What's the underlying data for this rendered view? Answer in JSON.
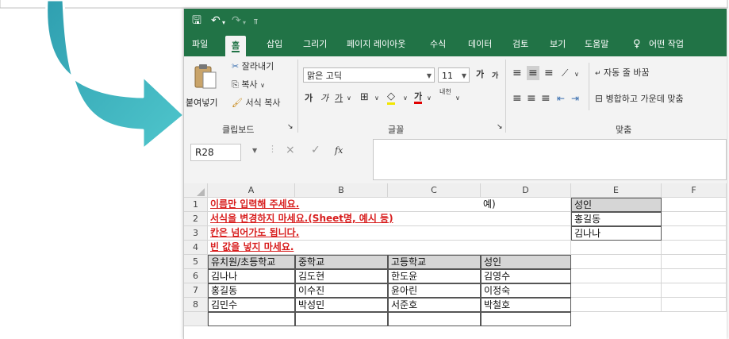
{
  "window": {
    "save_icon": "save-icon",
    "undo_icon": "undo-icon",
    "redo_icon": "redo-icon",
    "qat_icon": "customize-quick-access-icon"
  },
  "tabs": [
    {
      "label": "파일"
    },
    {
      "label": "홈"
    },
    {
      "label": "삽입"
    },
    {
      "label": "그리기"
    },
    {
      "label": "페이지 레이아웃"
    },
    {
      "label": "수식"
    },
    {
      "label": "데이터"
    },
    {
      "label": "검토"
    },
    {
      "label": "보기"
    },
    {
      "label": "도움말"
    },
    {
      "label": "어떤 작업"
    }
  ],
  "ribbon": {
    "clipboard": {
      "paste_label": "붙여넣기",
      "cut_label": "잘라내기",
      "copy_label": "복사",
      "format_painter_label": "서식 복사",
      "group_label": "클립보드"
    },
    "font": {
      "font_name": "맑은 고딕",
      "font_size": "11",
      "grow_label": "가",
      "shrink_label": "가",
      "bold_label": "가",
      "italic_label": "가",
      "underline_label": "가",
      "font_color_label": "가",
      "phonetic_label": "내천",
      "group_label": "글꼴"
    },
    "alignment": {
      "wrap_text_label": "자동 줄 바꿈",
      "merge_label": "병합하고 가운데 맞춤",
      "group_label": "맞춤"
    }
  },
  "formula_bar": {
    "name_box": "R28",
    "cancel_glyph": "×",
    "enter_glyph": "✓",
    "fx_label": "fx",
    "value": ""
  },
  "sheet": {
    "columns": [
      "A",
      "B",
      "C",
      "D",
      "E",
      "F"
    ],
    "rows": [
      "1",
      "2",
      "3",
      "4",
      "5",
      "6",
      "7",
      "8"
    ],
    "notes": [
      "이름만 입력해 주세요.",
      "서식을 변경하지 마세요.(Sheet명, 예시 등)",
      "칸은 넘어가도 됩니다.",
      "빈 값을 넣지 마세요."
    ],
    "example_label": "예)",
    "example_header": "성인",
    "example_values": [
      "홍길동",
      "김나나"
    ],
    "table_headers": [
      "유치원/초등학교",
      "중학교",
      "고등학교",
      "성인"
    ],
    "table_rows": [
      [
        "김나나",
        "김도현",
        "한도윤",
        "김영수"
      ],
      [
        "홍길동",
        "이수진",
        "윤아린",
        "이정숙"
      ],
      [
        "김민수",
        "박성민",
        "서준호",
        "박철호"
      ]
    ]
  },
  "colors": {
    "excel_green": "#217346",
    "arrow_teal": "#3db8c4",
    "note_red": "#d81e1e"
  }
}
